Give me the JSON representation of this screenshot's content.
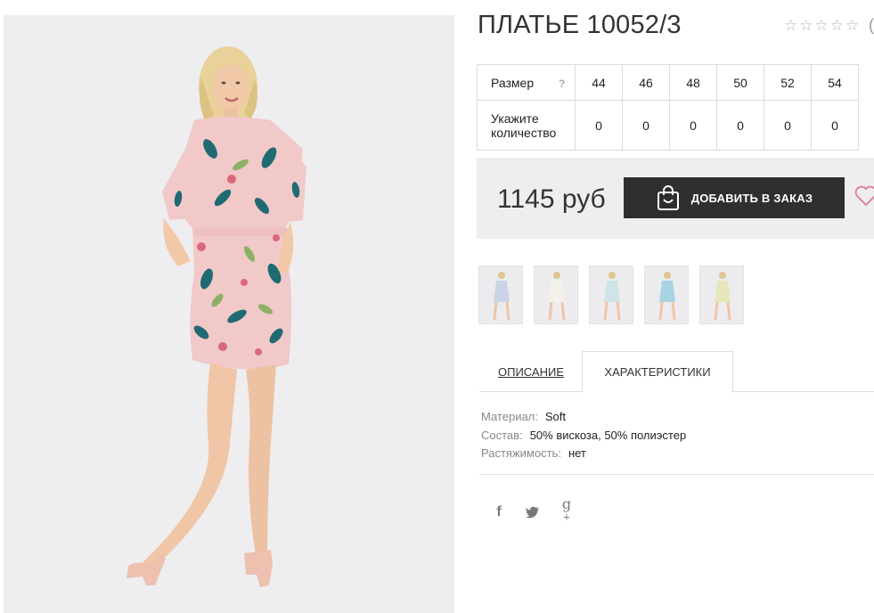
{
  "product": {
    "title": "ПЛАТЬЕ 10052/3",
    "rating": {
      "stars_filled": 0,
      "stars_total": 5,
      "count": "("
    }
  },
  "sizes": {
    "size_label": "Размер",
    "help_mark": "?",
    "qty_label_line1": "Укажите",
    "qty_label_line2": "количество",
    "items": [
      {
        "size": "44",
        "qty": "0"
      },
      {
        "size": "46",
        "qty": "0"
      },
      {
        "size": "48",
        "qty": "0"
      },
      {
        "size": "50",
        "qty": "0"
      },
      {
        "size": "52",
        "qty": "0"
      },
      {
        "size": "54",
        "qty": "0"
      }
    ]
  },
  "buy": {
    "price": "1145 руб",
    "add_button_label": "ДОБАВИТЬ В ЗАКАЗ",
    "cart_icon": "shopping-bag-icon",
    "wishlist_icon": "heart-icon"
  },
  "thumbnails": [
    {
      "dress_color": "#c9d4e6"
    },
    {
      "dress_color": "#f4f1ea"
    },
    {
      "dress_color": "#cfe4e6"
    },
    {
      "dress_color": "#a9d3e2"
    },
    {
      "dress_color": "#e6e7b8"
    }
  ],
  "tabs": {
    "description": "ОПИСАНИЕ",
    "characteristics": "ХАРАКТЕРИСТИКИ",
    "active": "characteristics"
  },
  "specs": [
    {
      "key": "Материал:",
      "value": "Soft"
    },
    {
      "key": "Состав:",
      "value": "50% вискоза, 50% полиэстер"
    },
    {
      "key": "Растяжимость:",
      "value": "нет"
    }
  ],
  "social": {
    "facebook": "f",
    "twitter": "twitter-bird-icon",
    "googleplus": "g"
  },
  "colors": {
    "accent_dark": "#2f2f2f",
    "buybar_bg": "#eeeeee",
    "heart": "#e0869c",
    "dress_main": "#f1c9c8"
  }
}
